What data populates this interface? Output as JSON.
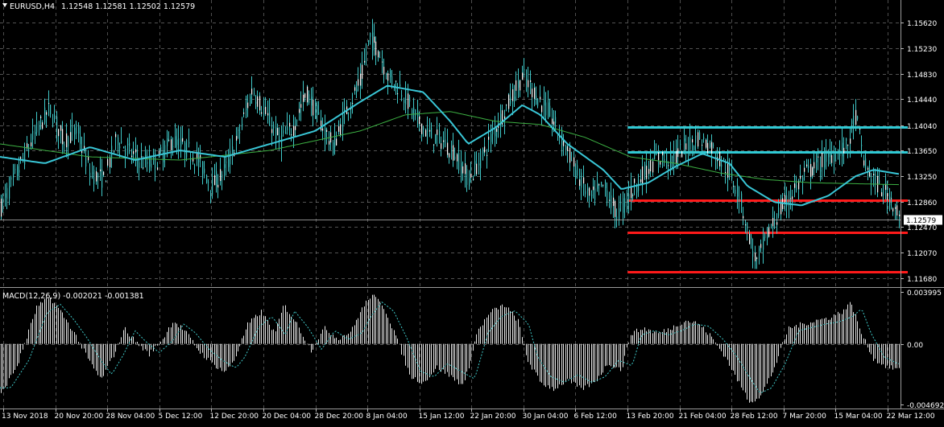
{
  "header": {
    "symbol_timeframe": "EURUSD,H4",
    "ohlc": "1.12548 1.12581 1.12502 1.12579"
  },
  "indicator_label": {
    "text": "MACD(12,26,9) -0.002021 -0.001381"
  },
  "current_price_label": "1.12579",
  "colors": {
    "background": "#000000",
    "grid": "#c8c8c8",
    "candles": "#3fc8c8",
    "ma_slow": "#39c6d6",
    "ma_fast": "#3cb043",
    "support": "#ff1a1a",
    "resistance": "#2fc9d4",
    "macd_hist": "#e6e6e6",
    "macd_signal": "#3fc8c8"
  },
  "chart_data": [
    {
      "type": "candlestick",
      "title": "EURUSD,H4",
      "y_ticks": [
        "1.15620",
        "1.15230",
        "1.14830",
        "1.14440",
        "1.14040",
        "1.13650",
        "1.13250",
        "1.12860",
        "1.12470",
        "1.12070",
        "1.11680"
      ],
      "ylim": [
        1.1155,
        1.1575
      ],
      "x_ticks": [
        "13 Nov 2018",
        "20 Nov 20:00",
        "28 Nov 04:00",
        "5 Dec 12:00",
        "12 Dec 20:00",
        "20 Dec 04:00",
        "28 Dec 20:00",
        "8 Jan 04:00",
        "15 Jan 12:00",
        "22 Jan 20:00",
        "30 Jan 04:00",
        "6 Feb 12:00",
        "13 Feb 20:00",
        "21 Feb 04:00",
        "28 Feb 12:00",
        "7 Mar 20:00",
        "15 Mar 04:00",
        "22 Mar 12:00"
      ],
      "current_price": 1.12579,
      "close_path": [
        {
          "t": 0,
          "v": 1.1275
        },
        {
          "t": 0.02,
          "v": 1.1335
        },
        {
          "t": 0.04,
          "v": 1.1395
        },
        {
          "t": 0.055,
          "v": 1.143
        },
        {
          "t": 0.07,
          "v": 1.138
        },
        {
          "t": 0.085,
          "v": 1.1395
        },
        {
          "t": 0.1,
          "v": 1.133
        },
        {
          "t": 0.115,
          "v": 1.132
        },
        {
          "t": 0.13,
          "v": 1.1385
        },
        {
          "t": 0.145,
          "v": 1.136
        },
        {
          "t": 0.16,
          "v": 1.1345
        },
        {
          "t": 0.175,
          "v": 1.135
        },
        {
          "t": 0.19,
          "v": 1.138
        },
        {
          "t": 0.205,
          "v": 1.137
        },
        {
          "t": 0.22,
          "v": 1.135
        },
        {
          "t": 0.235,
          "v": 1.131
        },
        {
          "t": 0.25,
          "v": 1.1335
        },
        {
          "t": 0.265,
          "v": 1.139
        },
        {
          "t": 0.28,
          "v": 1.146
        },
        {
          "t": 0.295,
          "v": 1.142
        },
        {
          "t": 0.31,
          "v": 1.138
        },
        {
          "t": 0.325,
          "v": 1.14
        },
        {
          "t": 0.34,
          "v": 1.1455
        },
        {
          "t": 0.355,
          "v": 1.141
        },
        {
          "t": 0.37,
          "v": 1.137
        },
        {
          "t": 0.385,
          "v": 1.143
        },
        {
          "t": 0.4,
          "v": 1.147
        },
        {
          "t": 0.41,
          "v": 1.154
        },
        {
          "t": 0.42,
          "v": 1.152
        },
        {
          "t": 0.43,
          "v": 1.148
        },
        {
          "t": 0.445,
          "v": 1.146
        },
        {
          "t": 0.46,
          "v": 1.142
        },
        {
          "t": 0.475,
          "v": 1.139
        },
        {
          "t": 0.49,
          "v": 1.138
        },
        {
          "t": 0.505,
          "v": 1.136
        },
        {
          "t": 0.52,
          "v": 1.132
        },
        {
          "t": 0.535,
          "v": 1.1355
        },
        {
          "t": 0.55,
          "v": 1.14
        },
        {
          "t": 0.565,
          "v": 1.144
        },
        {
          "t": 0.58,
          "v": 1.148
        },
        {
          "t": 0.595,
          "v": 1.145
        },
        {
          "t": 0.61,
          "v": 1.142
        },
        {
          "t": 0.625,
          "v": 1.138
        },
        {
          "t": 0.64,
          "v": 1.133
        },
        {
          "t": 0.655,
          "v": 1.129
        },
        {
          "t": 0.67,
          "v": 1.131
        },
        {
          "t": 0.685,
          "v": 1.1265
        },
        {
          "t": 0.7,
          "v": 1.13
        },
        {
          "t": 0.715,
          "v": 1.133
        },
        {
          "t": 0.73,
          "v": 1.1355
        },
        {
          "t": 0.745,
          "v": 1.135
        },
        {
          "t": 0.76,
          "v": 1.137
        },
        {
          "t": 0.775,
          "v": 1.1385
        },
        {
          "t": 0.79,
          "v": 1.137
        },
        {
          "t": 0.805,
          "v": 1.134
        },
        {
          "t": 0.82,
          "v": 1.13
        },
        {
          "t": 0.83,
          "v": 1.124
        },
        {
          "t": 0.84,
          "v": 1.119
        },
        {
          "t": 0.85,
          "v": 1.123
        },
        {
          "t": 0.865,
          "v": 1.127
        },
        {
          "t": 0.88,
          "v": 1.13
        },
        {
          "t": 0.895,
          "v": 1.133
        },
        {
          "t": 0.91,
          "v": 1.1345
        },
        {
          "t": 0.925,
          "v": 1.136
        },
        {
          "t": 0.94,
          "v": 1.137
        },
        {
          "t": 0.95,
          "v": 1.142
        },
        {
          "t": 0.96,
          "v": 1.134
        },
        {
          "t": 0.975,
          "v": 1.131
        },
        {
          "t": 0.99,
          "v": 1.129
        },
        {
          "t": 1,
          "v": 1.1258
        }
      ],
      "ma_slow_path": [
        {
          "t": 0,
          "v": 1.1355
        },
        {
          "t": 0.05,
          "v": 1.1345
        },
        {
          "t": 0.1,
          "v": 1.137
        },
        {
          "t": 0.15,
          "v": 1.135
        },
        {
          "t": 0.2,
          "v": 1.1365
        },
        {
          "t": 0.25,
          "v": 1.1355
        },
        {
          "t": 0.3,
          "v": 1.1375
        },
        {
          "t": 0.35,
          "v": 1.1395
        },
        {
          "t": 0.4,
          "v": 1.144
        },
        {
          "t": 0.43,
          "v": 1.1465
        },
        {
          "t": 0.47,
          "v": 1.1455
        },
        {
          "t": 0.5,
          "v": 1.141
        },
        {
          "t": 0.52,
          "v": 1.1375
        },
        {
          "t": 0.55,
          "v": 1.14
        },
        {
          "t": 0.58,
          "v": 1.1435
        },
        {
          "t": 0.6,
          "v": 1.142
        },
        {
          "t": 0.63,
          "v": 1.1375
        },
        {
          "t": 0.67,
          "v": 1.1335
        },
        {
          "t": 0.69,
          "v": 1.1305
        },
        {
          "t": 0.72,
          "v": 1.1315
        },
        {
          "t": 0.75,
          "v": 1.134
        },
        {
          "t": 0.78,
          "v": 1.136
        },
        {
          "t": 0.81,
          "v": 1.1345
        },
        {
          "t": 0.83,
          "v": 1.131
        },
        {
          "t": 0.86,
          "v": 1.1285
        },
        {
          "t": 0.89,
          "v": 1.128
        },
        {
          "t": 0.92,
          "v": 1.1295
        },
        {
          "t": 0.95,
          "v": 1.1325
        },
        {
          "t": 0.97,
          "v": 1.1335
        },
        {
          "t": 1,
          "v": 1.1328
        }
      ],
      "ma_fast_path": [
        {
          "t": 0,
          "v": 1.1375
        },
        {
          "t": 0.1,
          "v": 1.1355
        },
        {
          "t": 0.2,
          "v": 1.135
        },
        {
          "t": 0.3,
          "v": 1.1365
        },
        {
          "t": 0.4,
          "v": 1.1395
        },
        {
          "t": 0.45,
          "v": 1.142
        },
        {
          "t": 0.5,
          "v": 1.1425
        },
        {
          "t": 0.55,
          "v": 1.141
        },
        {
          "t": 0.6,
          "v": 1.1405
        },
        {
          "t": 0.65,
          "v": 1.1385
        },
        {
          "t": 0.7,
          "v": 1.1355
        },
        {
          "t": 0.75,
          "v": 1.1345
        },
        {
          "t": 0.8,
          "v": 1.133
        },
        {
          "t": 0.85,
          "v": 1.132
        },
        {
          "t": 0.9,
          "v": 1.1315
        },
        {
          "t": 1,
          "v": 1.1312
        }
      ],
      "horizontal_levels": [
        {
          "value": 1.1401,
          "t_start": 0.697,
          "kind": "resistance"
        },
        {
          "value": 1.1362,
          "t_start": 0.697,
          "kind": "resistance"
        },
        {
          "value": 1.12885,
          "t_start": 0.697,
          "kind": "support"
        },
        {
          "value": 1.1238,
          "t_start": 0.697,
          "kind": "support"
        },
        {
          "value": 1.1177,
          "t_start": 0.697,
          "kind": "support"
        }
      ]
    },
    {
      "type": "histogram",
      "title": "MACD(12,26,9) -0.002021 -0.001381",
      "y_ticks": [
        "0.003995",
        "0.00",
        "-0.004692"
      ],
      "ylim": [
        -0.005,
        0.0042
      ],
      "main_value": -0.002021,
      "signal_value": -0.001381,
      "hist_path": [
        {
          "t": 0,
          "v": -0.004
        },
        {
          "t": 0.02,
          "v": -0.0015
        },
        {
          "t": 0.04,
          "v": 0.0028
        },
        {
          "t": 0.055,
          "v": 0.0036
        },
        {
          "t": 0.07,
          "v": 0.0022
        },
        {
          "t": 0.085,
          "v": 0.0005
        },
        {
          "t": 0.1,
          "v": -0.0015
        },
        {
          "t": 0.112,
          "v": -0.0028
        },
        {
          "t": 0.125,
          "v": -0.001
        },
        {
          "t": 0.138,
          "v": 0.0012
        },
        {
          "t": 0.15,
          "v": 0.0002
        },
        {
          "t": 0.165,
          "v": -0.0008
        },
        {
          "t": 0.18,
          "v": 0.0003
        },
        {
          "t": 0.192,
          "v": 0.0018
        },
        {
          "t": 0.205,
          "v": 0.001
        },
        {
          "t": 0.22,
          "v": -0.0005
        },
        {
          "t": 0.235,
          "v": -0.0015
        },
        {
          "t": 0.25,
          "v": -0.0022
        },
        {
          "t": 0.26,
          "v": -0.0012
        },
        {
          "t": 0.275,
          "v": 0.0015
        },
        {
          "t": 0.29,
          "v": 0.0025
        },
        {
          "t": 0.305,
          "v": 0.0008
        },
        {
          "t": 0.315,
          "v": 0.003
        },
        {
          "t": 0.33,
          "v": 0.0015
        },
        {
          "t": 0.345,
          "v": -0.0005
        },
        {
          "t": 0.36,
          "v": 0.0012
        },
        {
          "t": 0.375,
          "v": 0.0004
        },
        {
          "t": 0.39,
          "v": 0.001
        },
        {
          "t": 0.4,
          "v": 0.0025
        },
        {
          "t": 0.412,
          "v": 0.0038
        },
        {
          "t": 0.425,
          "v": 0.003
        },
        {
          "t": 0.44,
          "v": 0.0005
        },
        {
          "t": 0.455,
          "v": -0.0025
        },
        {
          "t": 0.47,
          "v": -0.003
        },
        {
          "t": 0.485,
          "v": -0.0018
        },
        {
          "t": 0.5,
          "v": -0.0025
        },
        {
          "t": 0.515,
          "v": -0.0032
        },
        {
          "t": 0.53,
          "v": 0.001
        },
        {
          "t": 0.545,
          "v": 0.0025
        },
        {
          "t": 0.56,
          "v": 0.003
        },
        {
          "t": 0.575,
          "v": 0.0018
        },
        {
          "t": 0.585,
          "v": -0.0012
        },
        {
          "t": 0.6,
          "v": -0.003
        },
        {
          "t": 0.615,
          "v": -0.0035
        },
        {
          "t": 0.63,
          "v": -0.0028
        },
        {
          "t": 0.645,
          "v": -0.0035
        },
        {
          "t": 0.66,
          "v": -0.003
        },
        {
          "t": 0.675,
          "v": -0.0015
        },
        {
          "t": 0.69,
          "v": -0.002
        },
        {
          "t": 0.7,
          "v": 0.0008
        },
        {
          "t": 0.715,
          "v": 0.0012
        },
        {
          "t": 0.73,
          "v": 0.0008
        },
        {
          "t": 0.745,
          "v": 0.0012
        },
        {
          "t": 0.76,
          "v": 0.0018
        },
        {
          "t": 0.775,
          "v": 0.0016
        },
        {
          "t": 0.79,
          "v": 0.0005
        },
        {
          "t": 0.805,
          "v": -0.001
        },
        {
          "t": 0.82,
          "v": -0.003
        },
        {
          "t": 0.832,
          "v": -0.0045
        },
        {
          "t": 0.845,
          "v": -0.004
        },
        {
          "t": 0.86,
          "v": -0.0018
        },
        {
          "t": 0.875,
          "v": 0.0012
        },
        {
          "t": 0.89,
          "v": 0.0015
        },
        {
          "t": 0.905,
          "v": 0.0018
        },
        {
          "t": 0.92,
          "v": 0.002
        },
        {
          "t": 0.935,
          "v": 0.0025
        },
        {
          "t": 0.945,
          "v": 0.0032
        },
        {
          "t": 0.955,
          "v": 0.001
        },
        {
          "t": 0.97,
          "v": -0.0012
        },
        {
          "t": 0.985,
          "v": -0.0018
        },
        {
          "t": 1,
          "v": -0.002
        }
      ]
    }
  ]
}
